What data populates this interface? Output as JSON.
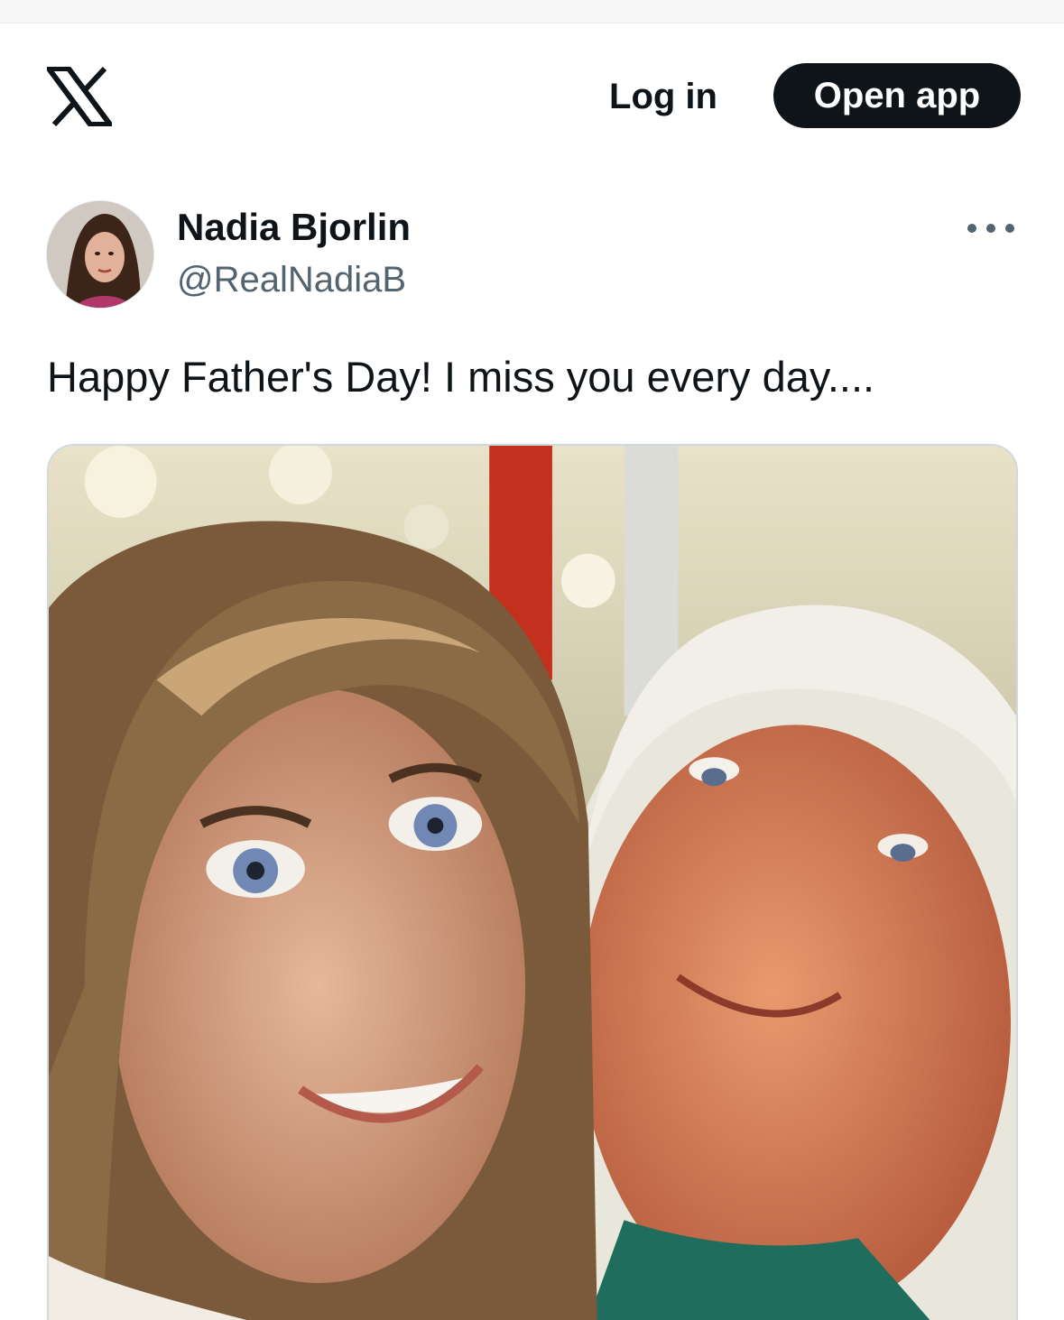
{
  "header": {
    "logo_icon": "x-logo-icon",
    "login_label": "Log in",
    "open_app_label": "Open app"
  },
  "tweet": {
    "author": {
      "display_name": "Nadia Bjorlin",
      "handle": "@RealNadiaB",
      "avatar_icon": "avatar-photo"
    },
    "more_icon": "more-options-icon",
    "text": "Happy Father's Day! I miss you every day....",
    "media": {
      "type": "photo",
      "alt": ""
    }
  },
  "colors": {
    "text_primary": "#0f1419",
    "text_secondary": "#536471",
    "button_bg": "#0f1419",
    "button_text": "#ffffff",
    "border": "#cfd9de"
  }
}
